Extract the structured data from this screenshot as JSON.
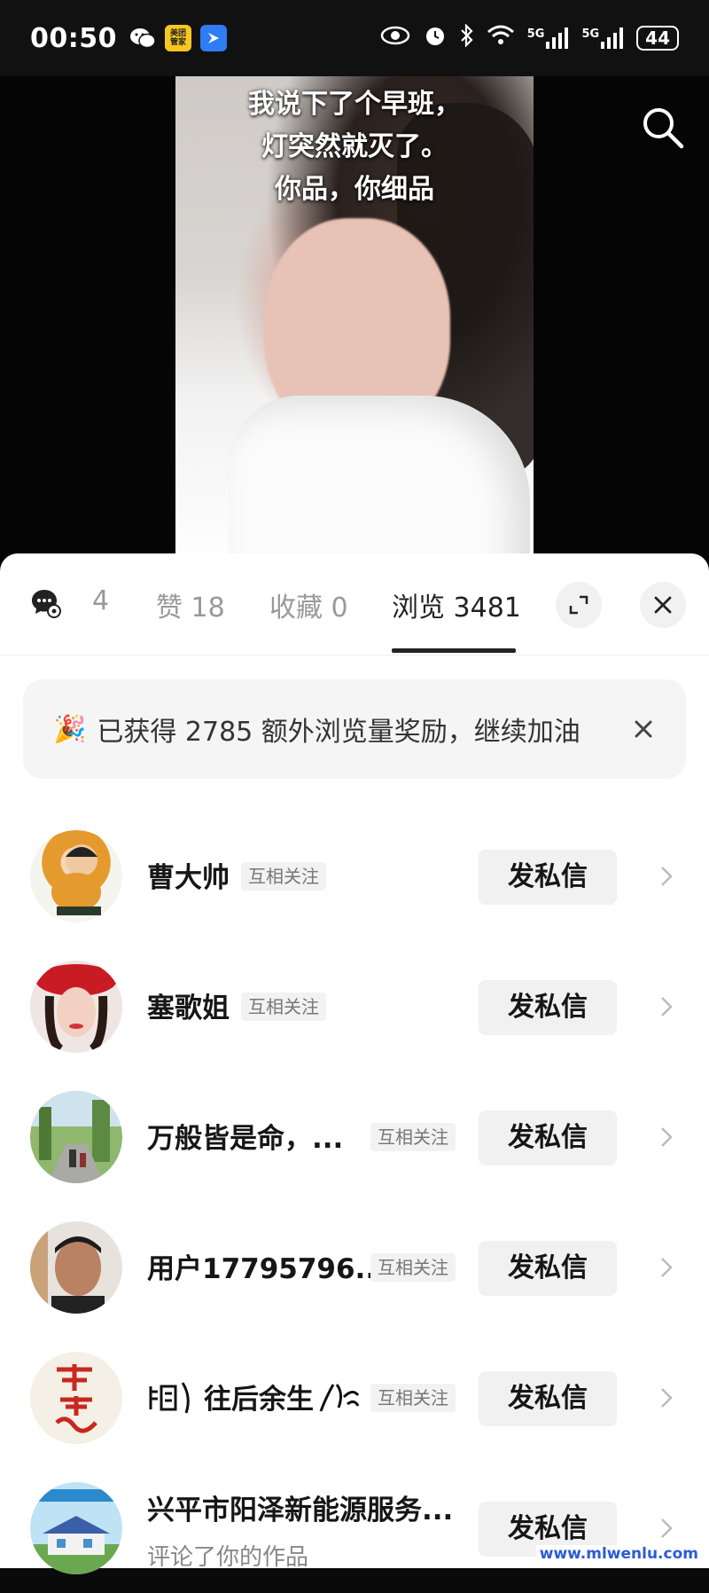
{
  "status_bar": {
    "time": "00:50",
    "icon_app_label": "美团\n管家",
    "signal_1": "5G",
    "signal_2": "5G",
    "battery": "44"
  },
  "video": {
    "caption_lines": [
      "我说下了个早班，",
      "灯突然就灭了。",
      "你品，你细品"
    ]
  },
  "tabs": [
    {
      "label": "4",
      "active": false
    },
    {
      "label": "赞 18",
      "active": false
    },
    {
      "label": "收藏 0",
      "active": false
    },
    {
      "label": "浏览 3481",
      "active": true
    }
  ],
  "reward": {
    "emoji": "🎉",
    "text": "已获得 2785 额外浏览量奖励，继续加油"
  },
  "users": [
    {
      "name": "曹大帅",
      "badge": "互相关注",
      "button": "发私信"
    },
    {
      "name": "塞歌姐",
      "badge": "互相关注",
      "button": "发私信"
    },
    {
      "name": "万般皆是命，...",
      "badge": "互相关注",
      "button": "发私信"
    },
    {
      "name": "用户17795796...",
      "badge": "互相关注",
      "button": "发私信"
    },
    {
      "name": "往后余生",
      "badge": "互相关注",
      "button": "发私信"
    },
    {
      "name": "兴平市阳泽新能源服务...",
      "sub": "评论了你的作品",
      "button": "发私信"
    }
  ],
  "watermark": "www.mlwenlu.com",
  "colors": {
    "accent_text": "#161616",
    "muted": "#999999",
    "sheet_bg": "#ffffff"
  }
}
